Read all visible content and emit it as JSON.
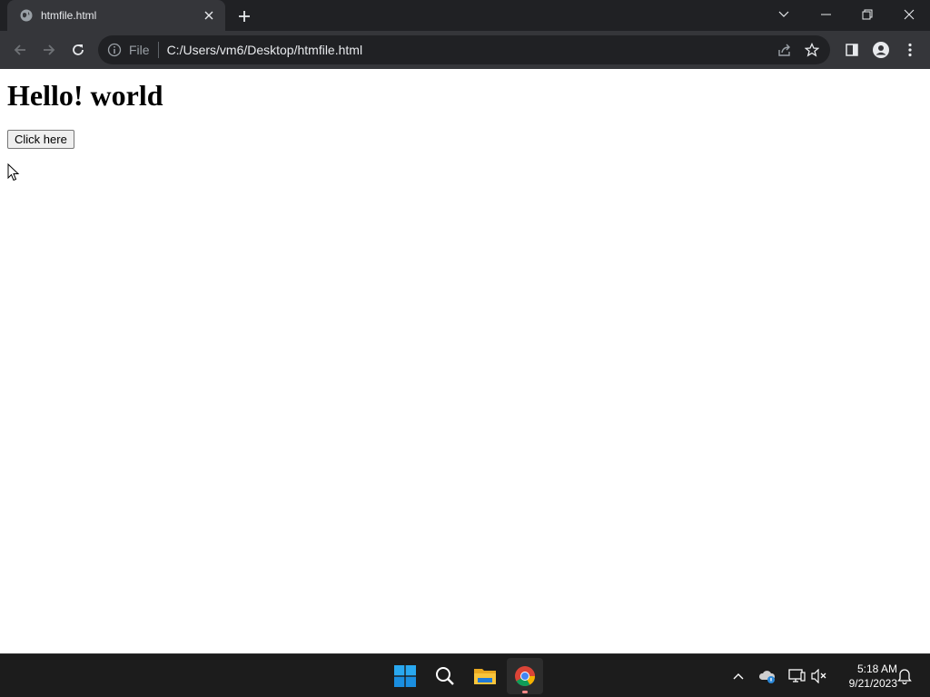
{
  "browser": {
    "tab": {
      "title": "htmfile.html"
    },
    "address_bar": {
      "scheme": "File",
      "url": "C:/Users/vm6/Desktop/htmfile.html"
    }
  },
  "page": {
    "heading": "Hello! world",
    "button_label": "Click here"
  },
  "taskbar": {
    "time": "5:18 AM",
    "date": "9/21/2023"
  },
  "colors": {
    "titlebar_bg": "#202124",
    "toolbar_bg": "#35363a",
    "omnibox_bg": "#202124",
    "taskbar_bg": "#1c1c1c",
    "windows_blue": "#0078d4",
    "folder_yellow": "#f8c43b"
  },
  "icons": {
    "tab_favicon": "globe-icon",
    "tab_close": "close-icon",
    "new_tab": "plus-icon",
    "tab_search": "chevron-down-icon",
    "minimize": "minimize-icon",
    "restore": "restore-icon",
    "window_close": "close-icon",
    "back": "arrow-left-icon",
    "forward": "arrow-right-icon",
    "reload": "reload-icon",
    "site_info": "info-icon",
    "share": "share-icon",
    "bookmark": "star-icon",
    "side_panel": "side-panel-icon",
    "profile": "profile-icon",
    "menu": "kebab-menu-icon",
    "start": "windows-start-icon",
    "search": "search-icon",
    "file_explorer": "folder-icon",
    "chrome": "chrome-icon",
    "tray_overflow": "chevron-up-icon",
    "onedrive": "cloud-icon",
    "network": "network-icon",
    "volume": "volume-muted-icon",
    "notifications": "bell-icon"
  }
}
